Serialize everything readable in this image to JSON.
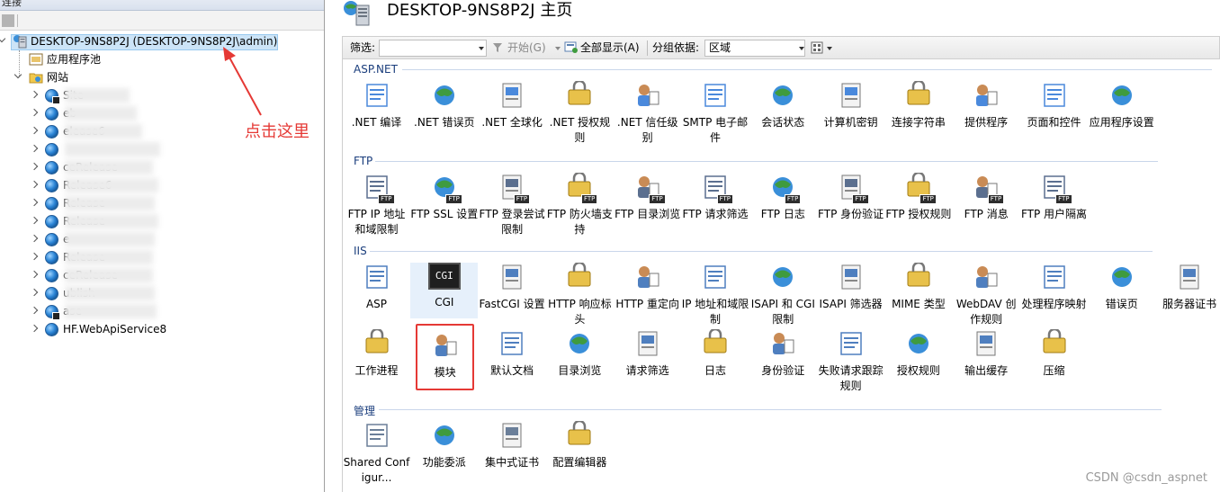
{
  "left_panel": {
    "header_label": "连接",
    "server_node": "DESKTOP-9NS8P2J (DESKTOP-9NS8P2J\\admin)",
    "app_pools": "应用程序池",
    "sites": "网站",
    "site_items": [
      {
        "label": "Site",
        "stopped": true
      },
      {
        "label": "eb",
        "stopped": false
      },
      {
        "label": "elease6",
        "stopped": false
      },
      {
        "label": "",
        "stopped": false
      },
      {
        "label": "ceRelease",
        "stopped": false
      },
      {
        "label": "Release6",
        "stopped": false
      },
      {
        "label": "Release",
        "stopped": false
      },
      {
        "label": "Release",
        "stopped": false
      },
      {
        "label": "e",
        "stopped": false
      },
      {
        "label": "Release",
        "stopped": false
      },
      {
        "label": "ceRelease",
        "stopped": false
      },
      {
        "label": "ublish",
        "stopped": false
      },
      {
        "label": "ase",
        "stopped": true
      },
      {
        "label": "HF.WebApiService8",
        "stopped": false
      }
    ],
    "annotation": "点击这里"
  },
  "main": {
    "title": "DESKTOP-9NS8P2J 主页",
    "filterbar": {
      "filter_label": "筛选:",
      "start_label": "开始(G)",
      "show_all_label": "全部显示(A)",
      "group_by_label": "分组依据:",
      "group_by_value": "区域"
    },
    "groups": [
      {
        "name": "ASP.NET",
        "items": [
          {
            "label": ".NET 编译",
            "icon": "net-compile-icon"
          },
          {
            "label": ".NET 错误页",
            "icon": "net-error-pages-icon"
          },
          {
            "label": ".NET 全球化",
            "icon": "net-globalization-icon"
          },
          {
            "label": ".NET 授权规则",
            "icon": "net-authorization-icon"
          },
          {
            "label": ".NET 信任级别",
            "icon": "net-trust-levels-icon"
          },
          {
            "label": "SMTP 电子邮件",
            "icon": "smtp-email-icon"
          },
          {
            "label": "会话状态",
            "icon": "session-state-icon"
          },
          {
            "label": "计算机密钥",
            "icon": "machine-key-icon"
          },
          {
            "label": "连接字符串",
            "icon": "connection-strings-icon"
          },
          {
            "label": "提供程序",
            "icon": "providers-icon"
          },
          {
            "label": "页面和控件",
            "icon": "pages-controls-icon"
          },
          {
            "label": "应用程序设置",
            "icon": "app-settings-icon"
          }
        ]
      },
      {
        "name": "FTP",
        "items": [
          {
            "label": "FTP IP 地址和域限制",
            "icon": "ftp-ip-restrictions-icon"
          },
          {
            "label": "FTP SSL 设置",
            "icon": "ftp-ssl-icon"
          },
          {
            "label": "FTP 登录尝试限制",
            "icon": "ftp-logon-attempts-icon"
          },
          {
            "label": "FTP 防火墙支持",
            "icon": "ftp-firewall-icon"
          },
          {
            "label": "FTP 目录浏览",
            "icon": "ftp-directory-browsing-icon"
          },
          {
            "label": "FTP 请求筛选",
            "icon": "ftp-request-filtering-icon"
          },
          {
            "label": "FTP 日志",
            "icon": "ftp-logging-icon"
          },
          {
            "label": "FTP 身份验证",
            "icon": "ftp-authentication-icon"
          },
          {
            "label": "FTP 授权规则",
            "icon": "ftp-authorization-icon"
          },
          {
            "label": "FTP 消息",
            "icon": "ftp-messages-icon"
          },
          {
            "label": "FTP 用户隔离",
            "icon": "ftp-user-isolation-icon"
          }
        ]
      },
      {
        "name": "IIS",
        "items": [
          {
            "label": "ASP",
            "icon": "asp-icon"
          },
          {
            "label": "CGI",
            "icon": "cgi-icon"
          },
          {
            "label": "FastCGI 设置",
            "icon": "fastcgi-icon"
          },
          {
            "label": "HTTP 响应标头",
            "icon": "http-response-headers-icon"
          },
          {
            "label": "HTTP 重定向",
            "icon": "http-redirect-icon"
          },
          {
            "label": "IP 地址和域限制",
            "icon": "ip-restrictions-icon"
          },
          {
            "label": "ISAPI 和 CGI 限制",
            "icon": "isapi-cgi-restrictions-icon"
          },
          {
            "label": "ISAPI 筛选器",
            "icon": "isapi-filters-icon"
          },
          {
            "label": "MIME 类型",
            "icon": "mime-types-icon"
          },
          {
            "label": "WebDAV 创作规则",
            "icon": "webdav-icon"
          },
          {
            "label": "处理程序映射",
            "icon": "handler-mappings-icon"
          },
          {
            "label": "错误页",
            "icon": "error-pages-icon"
          },
          {
            "label": "服务器证书",
            "icon": "server-certificates-icon"
          },
          {
            "label": "工作进程",
            "icon": "worker-processes-icon"
          },
          {
            "label": "模块",
            "icon": "modules-icon"
          },
          {
            "label": "默认文档",
            "icon": "default-document-icon"
          },
          {
            "label": "目录浏览",
            "icon": "directory-browsing-icon"
          },
          {
            "label": "请求筛选",
            "icon": "request-filtering-icon"
          },
          {
            "label": "日志",
            "icon": "logging-icon"
          },
          {
            "label": "身份验证",
            "icon": "authentication-icon"
          },
          {
            "label": "失败请求跟踪规则",
            "icon": "failed-request-tracing-icon"
          },
          {
            "label": "授权规则",
            "icon": "authorization-rules-icon"
          },
          {
            "label": "输出缓存",
            "icon": "output-caching-icon"
          },
          {
            "label": "压缩",
            "icon": "compression-icon"
          }
        ]
      },
      {
        "name": "管理",
        "items": [
          {
            "label": "Shared Configur...",
            "icon": "shared-config-icon"
          },
          {
            "label": "功能委派",
            "icon": "feature-delegation-icon"
          },
          {
            "label": "集中式证书",
            "icon": "centralized-certificates-icon"
          },
          {
            "label": "配置编辑器",
            "icon": "configuration-editor-icon"
          }
        ]
      }
    ],
    "cgi_label": "CGI",
    "highlighted_item": "模块"
  },
  "watermark": "CSDN @csdn_aspnet"
}
